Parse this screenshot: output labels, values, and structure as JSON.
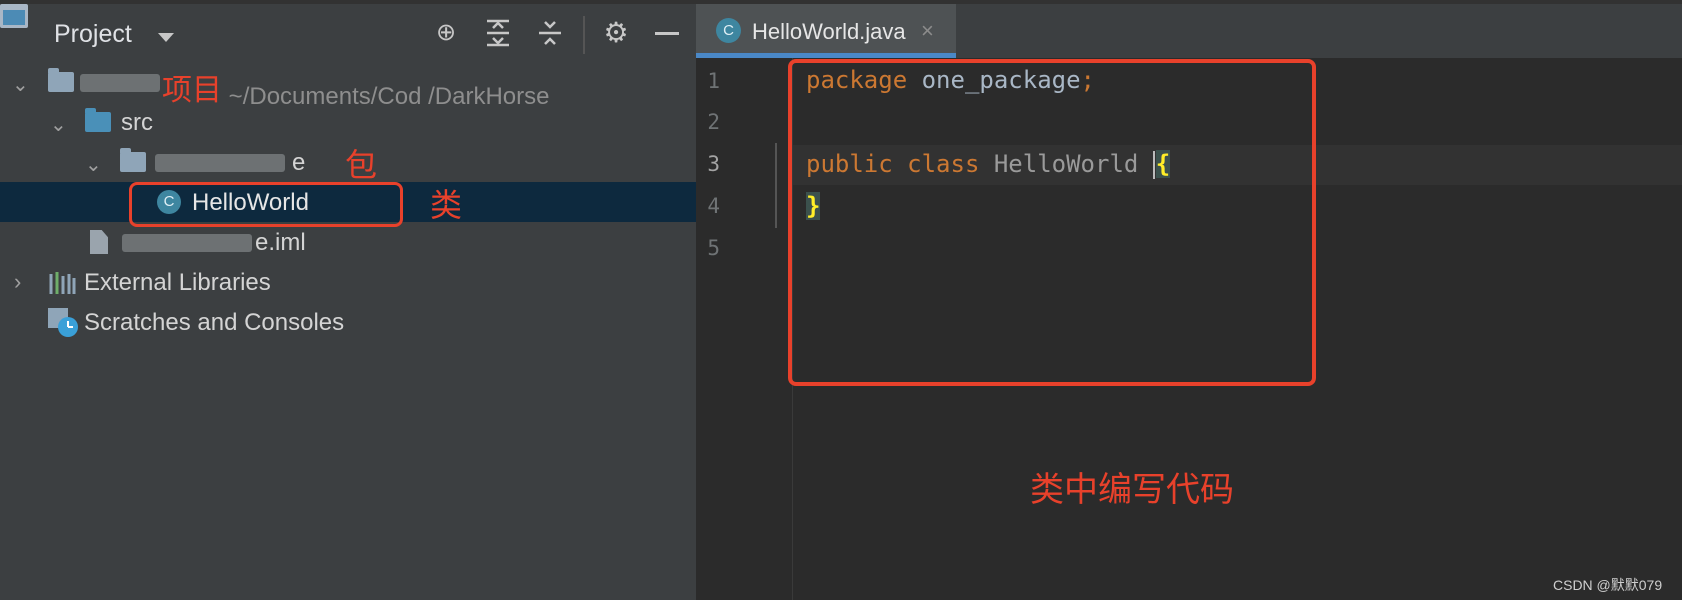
{
  "project_panel": {
    "title": "Project",
    "tree": {
      "project_row": {
        "label": "项目 ~/Documents/Cod  /DarkHorse"
      },
      "src_row": {
        "label": "src"
      },
      "package_row": {
        "label": "e"
      },
      "class_row": {
        "label": "HelloWorld"
      },
      "module_file_row": {
        "label": "e.iml"
      },
      "external_libraries_row": {
        "label": "External Libraries"
      },
      "scratches_row": {
        "label": "Scratches and Consoles"
      }
    }
  },
  "annotations": {
    "project": "项目",
    "package": "包",
    "class": "类",
    "code": "类中编写代码"
  },
  "editor": {
    "tab": {
      "label": "HelloWorld.java",
      "close_glyph": "×",
      "class_glyph": "C"
    },
    "line_numbers": [
      "1",
      "2",
      "3",
      "4",
      "5"
    ],
    "code": {
      "line1_keyword": "package",
      "line1_name": " one_package",
      "line1_semi": ";",
      "line3_keyword1": "public",
      "line3_keyword2": " class",
      "line3_class": " HelloWorld ",
      "line3_brace": "{",
      "line4_brace": "}"
    }
  },
  "watermark": "CSDN @默默079",
  "colors": {
    "accent_red": "#e8412b",
    "selection": "#0d293e",
    "keyword": "#cc7832",
    "tab_underline": "#4a88c7"
  }
}
